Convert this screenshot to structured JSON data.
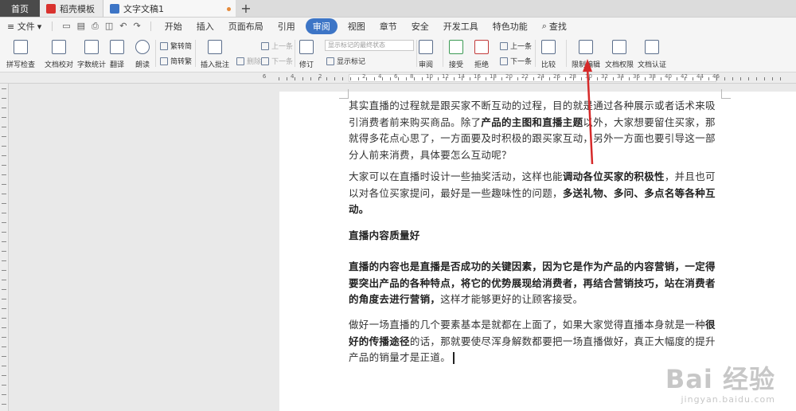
{
  "tabs": {
    "home": "首页",
    "template": "稻壳模板",
    "document": "文字文稿1",
    "close": "×",
    "new_tab": "+"
  },
  "menu": {
    "file": "≡ 文件",
    "file_arrow": "▾",
    "items": [
      "开始",
      "插入",
      "页面布局",
      "引用",
      "审阅",
      "视图",
      "章节",
      "安全",
      "开发工具",
      "特色功能"
    ],
    "active": "审阅",
    "search": "查找"
  },
  "ribbon": {
    "spell_check": "拼写检查",
    "doc_proof": "文档校对",
    "word_count": "字数统计",
    "translate": "翻译",
    "read_aloud": "朗读",
    "trad_to_simp": "繁转简",
    "simp_to_trad": "简转繁",
    "insert_comment": "插入批注",
    "delete": "删除",
    "prev_comment": "上一条",
    "next_comment": "下一条",
    "track_changes": "修订",
    "display_state": "显示标记的最终状态",
    "show_markup": "显示标记",
    "review": "审阅",
    "accept": "接受",
    "reject": "拒绝",
    "prev": "上一条",
    "next": "下一条",
    "compare": "比较",
    "restrict_editing": "限制编辑",
    "doc_permission": "文档权限",
    "doc_certify": "文档认证"
  },
  "ruler": {
    "left_marks": [
      "6",
      "4",
      "2"
    ],
    "right_marks": [
      "2",
      "4",
      "6",
      "8",
      "10",
      "12",
      "14",
      "16",
      "18",
      "20",
      "22",
      "24",
      "26",
      "28",
      "30",
      "32",
      "34",
      "36",
      "38",
      "40",
      "42",
      "44",
      "46"
    ]
  },
  "document": {
    "p1": {
      "a": "其实直播的过程就是跟买家不断互动的过程，目的就是通过各种展示或者话术来吸引消费者前来购买商品。除了",
      "b": "产品的主图和直播主题",
      "c": "以外，大家想要留住买家，那就得多花点心思了，一方面要及时积极的跟买家互动，另外一方面也要引导这一部分人前来消费，具体要怎么互动呢？"
    },
    "p2": {
      "a": "大家可以在直播时设计一些抽奖活动，这样也能",
      "b": "调动各位买家的积极性",
      "c": "，并且也可以对各位买家提问，最好是一些趣味性的问题，",
      "d": "多送礼物、多问、多点名等各种互动。"
    },
    "heading": "直播内容质量好",
    "p3": {
      "a": "直播的内容也是直播是否成功的关键因素，因为它是作为产品的内容营销，一定得要突出产品的各种特点，将它的优势展现给消费者，再结合营销技巧，站在消费者的角度去进行营销，",
      "b": "这样才能够更好的让顾客接受。"
    },
    "p4": {
      "a": "做好一场直播的几个要素基本是就都在上面了，如果大家觉得直播本身就是一种",
      "b": "很好的传播途径",
      "c": "的话，那就要使尽浑身解数都要把一场直播做好，真正大幅度的提升产品的销量才是正道。"
    }
  },
  "watermark": {
    "logo": "Bai 经验",
    "url": "jingyan.baidu.com"
  },
  "colors": {
    "active_menu": "#3d75c6",
    "arrow": "#d62a2a",
    "home_tab": "#4a4a4a"
  }
}
